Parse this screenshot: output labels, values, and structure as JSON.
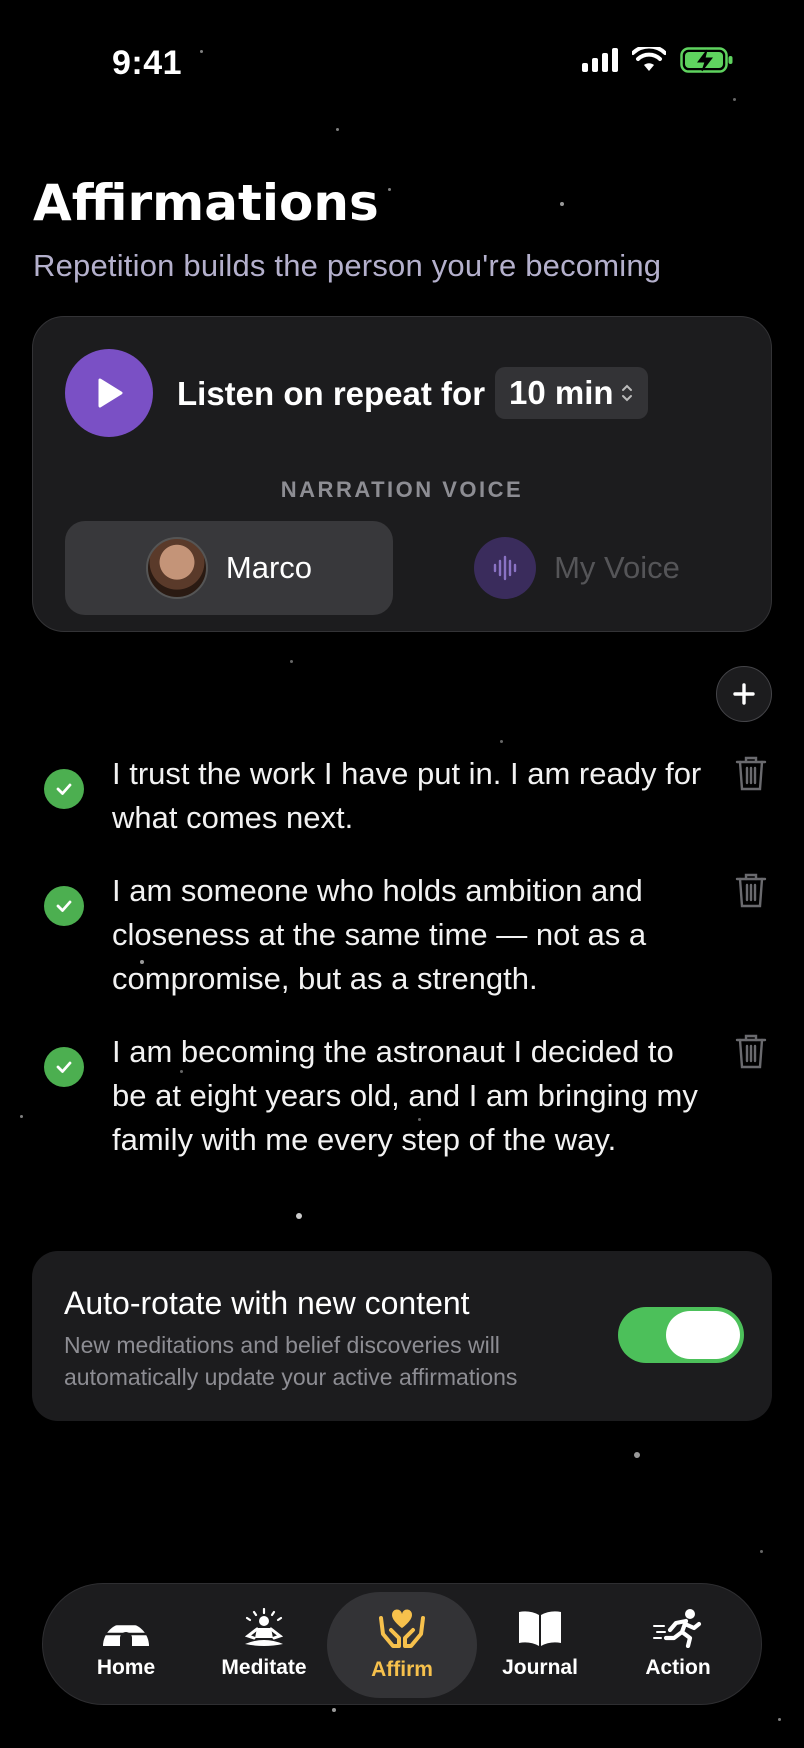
{
  "status_bar": {
    "time": "9:41"
  },
  "header": {
    "title": "Affirmations",
    "subtitle": "Repetition builds the person you're becoming"
  },
  "player": {
    "listen_label": "Listen on repeat for",
    "duration": "10 min",
    "narration_label": "NARRATION VOICE",
    "voices": [
      {
        "name": "Marco",
        "selected": true
      },
      {
        "name": "My Voice",
        "selected": false
      }
    ]
  },
  "affirmations": [
    {
      "text": "I trust the work I have put in. I am ready for what comes next.",
      "checked": true
    },
    {
      "text": "I am someone who holds ambition and closeness at the same time — not as a compromise, but as a strength.",
      "checked": true
    },
    {
      "text": "I am becoming the astronaut I decided to be at eight years old, and I am bringing my family with me every step of the way.",
      "checked": true
    }
  ],
  "auto_rotate": {
    "title": "Auto-rotate with new content",
    "description": "New meditations and belief discoveries will automatically update your active affirmations",
    "enabled": true
  },
  "tabbar": {
    "tabs": [
      {
        "label": "Home",
        "icon": "igloo-home-icon",
        "active": false
      },
      {
        "label": "Meditate",
        "icon": "meditate-icon",
        "active": false
      },
      {
        "label": "Affirm",
        "icon": "hands-heart-icon",
        "active": true
      },
      {
        "label": "Journal",
        "icon": "open-book-icon",
        "active": false
      },
      {
        "label": "Action",
        "icon": "running-person-icon",
        "active": false
      }
    ]
  },
  "colors": {
    "accent_purple": "#7a50c5",
    "check_green": "#4caf50",
    "toggle_green": "#4cc05a",
    "active_tab": "#f7c14c"
  }
}
